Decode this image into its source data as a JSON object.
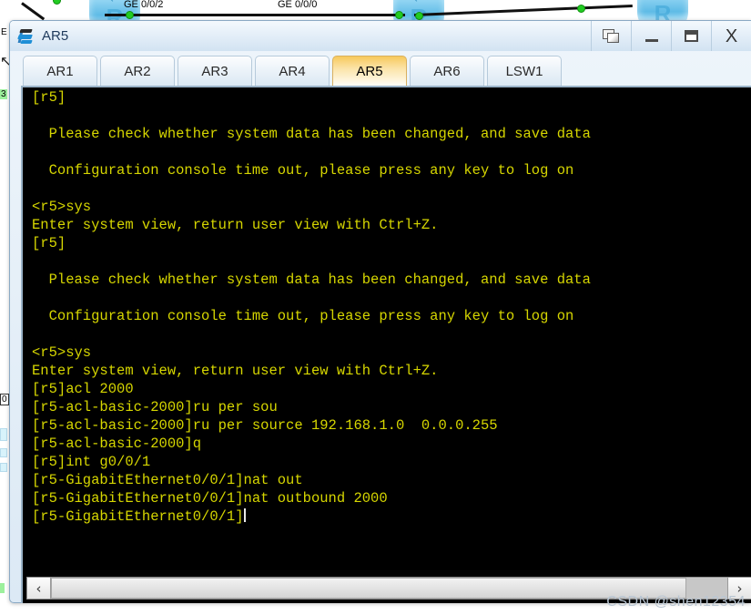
{
  "topology": {
    "link_labels": [
      "GE 0/0/2",
      "GE 0/0/0"
    ],
    "router_glyph": "router-icon",
    "router_letter": "R"
  },
  "window": {
    "title": "AR5",
    "icon": "router-icon",
    "controls": {
      "cascade": "cascade-windows-icon",
      "minimize": "minimize-icon",
      "maximize": "maximize-icon",
      "close": "X"
    }
  },
  "tabs": {
    "active_index": 4,
    "items": [
      {
        "label": "AR1"
      },
      {
        "label": "AR2"
      },
      {
        "label": "AR3"
      },
      {
        "label": "AR4"
      },
      {
        "label": "AR5"
      },
      {
        "label": "AR6"
      },
      {
        "label": "LSW1"
      }
    ]
  },
  "console": {
    "foreground_color": "#d6d600",
    "background_color": "#000000",
    "lines": [
      "[r5]",
      "",
      "  Please check whether system data has been changed, and save data",
      "",
      "  Configuration console time out, please press any key to log on",
      "",
      "<r5>sys",
      "Enter system view, return user view with Ctrl+Z.",
      "[r5]",
      "",
      "  Please check whether system data has been changed, and save data",
      "",
      "  Configuration console time out, please press any key to log on",
      "",
      "<r5>sys",
      "Enter system view, return user view with Ctrl+Z.",
      "[r5]acl 2000",
      "[r5-acl-basic-2000]ru per sou",
      "[r5-acl-basic-2000]ru per source 192.168.1.0  0.0.0.255",
      "[r5-acl-basic-2000]q",
      "[r5]int g0/0/1",
      "[r5-GigabitEthernet0/0/1]nat out",
      "[r5-GigabitEthernet0/0/1]nat outbound 2000"
    ],
    "prompt_line": "[r5-GigabitEthernet0/0/1]"
  },
  "scrollbar": {
    "left_arrow": "‹",
    "right_arrow": "›"
  },
  "watermark": {
    "text": "CSDN @shen12354"
  }
}
